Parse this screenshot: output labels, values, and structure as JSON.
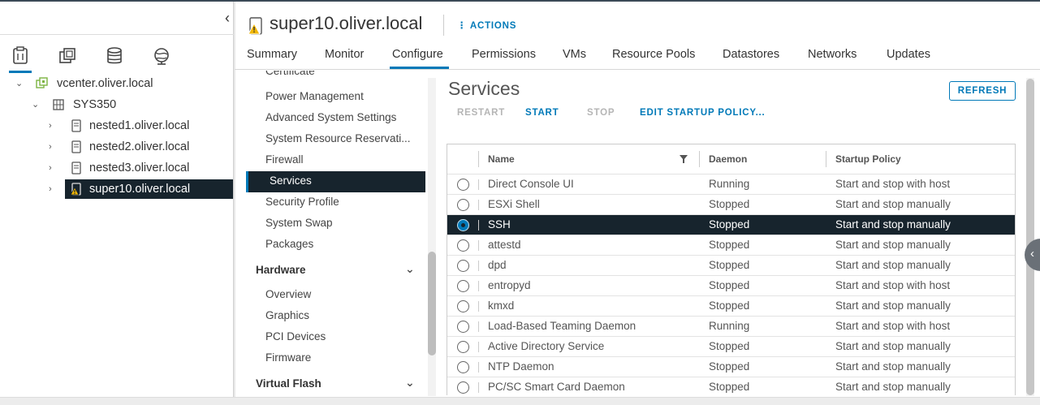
{
  "nav": {
    "collapse_label": "‹",
    "tree": [
      {
        "label": "vcenter.oliver.local",
        "icon": "datacenter-icon",
        "chevron": "⌄"
      },
      {
        "label": "SYS350",
        "icon": "cluster-icon",
        "chevron": "⌄"
      },
      {
        "label": "nested1.oliver.local",
        "icon": "host-icon",
        "chevron": "›"
      },
      {
        "label": "nested2.oliver.local",
        "icon": "host-icon",
        "chevron": "›"
      },
      {
        "label": "nested3.oliver.local",
        "icon": "host-icon",
        "chevron": "›"
      },
      {
        "label": "super10.oliver.local",
        "icon": "host-warning-icon",
        "chevron": "›"
      }
    ]
  },
  "header": {
    "title": "super10.oliver.local",
    "actions_label": "⋮ ACTIONS",
    "tabs": [
      "Summary",
      "Monitor",
      "Configure",
      "Permissions",
      "VMs",
      "Resource Pools",
      "Datastores",
      "Networks",
      "Updates"
    ]
  },
  "settings_menu": {
    "items_top": [
      "Certificate",
      "Power Management",
      "Advanced System Settings",
      "System Resource Reservati...",
      "Firewall",
      "Services",
      "Security Profile",
      "System Swap",
      "Packages"
    ],
    "hardware_header": "Hardware",
    "hardware_items": [
      "Overview",
      "Graphics",
      "PCI Devices",
      "Firmware"
    ],
    "virtual_flash_header": "Virtual Flash",
    "chevron": "⌄"
  },
  "services": {
    "title": "Services",
    "refresh_label": "REFRESH",
    "restart_label": "RESTART",
    "start_label": "START",
    "stop_label": "STOP",
    "edit_policy_label": "EDIT STARTUP POLICY...",
    "columns": [
      "Name",
      "Daemon",
      "Startup Policy"
    ],
    "filter_icon": "filter-icon",
    "rows": [
      {
        "name": "Direct Console UI",
        "daemon": "Running",
        "policy": "Start and stop with host"
      },
      {
        "name": "ESXi Shell",
        "daemon": "Stopped",
        "policy": "Start and stop manually"
      },
      {
        "name": "SSH",
        "daemon": "Stopped",
        "policy": "Start and stop manually"
      },
      {
        "name": "attestd",
        "daemon": "Stopped",
        "policy": "Start and stop manually"
      },
      {
        "name": "dpd",
        "daemon": "Stopped",
        "policy": "Start and stop manually"
      },
      {
        "name": "entropyd",
        "daemon": "Stopped",
        "policy": "Start and stop with host"
      },
      {
        "name": "kmxd",
        "daemon": "Stopped",
        "policy": "Start and stop manually"
      },
      {
        "name": "Load-Based Teaming Daemon",
        "daemon": "Running",
        "policy": "Start and stop with host"
      },
      {
        "name": "Active Directory Service",
        "daemon": "Stopped",
        "policy": "Start and stop manually"
      },
      {
        "name": "NTP Daemon",
        "daemon": "Stopped",
        "policy": "Start and stop manually"
      },
      {
        "name": "PC/SC Smart Card Daemon",
        "daemon": "Stopped",
        "policy": "Start and stop manually"
      }
    ]
  },
  "colors": {
    "accent": "#0079b8",
    "selected_bg": "#17242d",
    "warning": "#f2b705"
  }
}
